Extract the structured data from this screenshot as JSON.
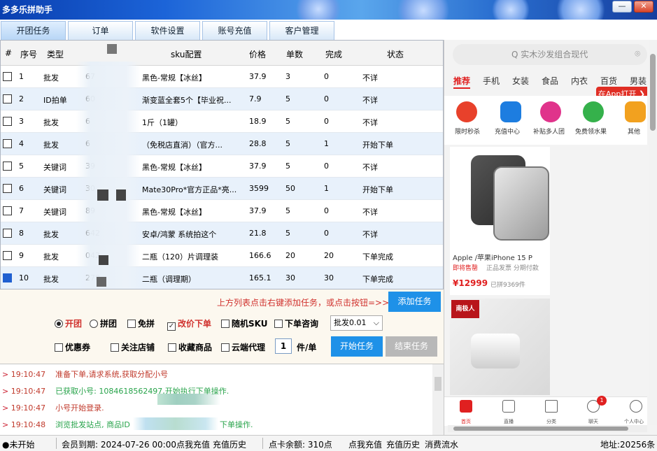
{
  "app": {
    "title": "多多乐拼助手",
    "min": "—",
    "close": "✕"
  },
  "tabs": [
    {
      "label": "开团任务"
    },
    {
      "label": "订单"
    },
    {
      "label": "软件设置"
    },
    {
      "label": "账号充值"
    },
    {
      "label": "客户管理"
    }
  ],
  "grid": {
    "columns": [
      "#",
      "序号",
      "类型",
      "sku配置",
      "价格",
      "单数",
      "完成",
      "状态"
    ],
    "rows": [
      {
        "no": "1",
        "type": "批发",
        "id": "67",
        "sku": "黑色-常规【冰丝】",
        "price": "37.9",
        "count": "3",
        "done": "0",
        "status": "不详"
      },
      {
        "no": "2",
        "type": "ID拍单",
        "id": "60",
        "sku": "渐变蓝全套5个【毕业祝...",
        "price": "7.9",
        "count": "5",
        "done": "0",
        "status": "不详"
      },
      {
        "no": "3",
        "type": "批发",
        "id": "6",
        "sku": "1斤（1罐）",
        "price": "18.9",
        "count": "5",
        "done": "0",
        "status": "不详"
      },
      {
        "no": "4",
        "type": "批发",
        "id": "6",
        "sku": "（免税店直消）（官方...",
        "price": "28.8",
        "count": "5",
        "done": "1",
        "status": "开始下单"
      },
      {
        "no": "5",
        "type": "关键词",
        "id": "39",
        "sku": "黑色-常规【冰丝】",
        "price": "37.9",
        "count": "5",
        "done": "0",
        "status": "不详"
      },
      {
        "no": "6",
        "type": "关键词",
        "id": "30",
        "sku": "Mate30Pro*官方正品*亮...",
        "price": "3599",
        "count": "50",
        "done": "1",
        "status": "开始下单"
      },
      {
        "no": "7",
        "type": "关键词",
        "id": "89",
        "sku": "黑色-常规【冰丝】",
        "price": "37.9",
        "count": "5",
        "done": "0",
        "status": "不详"
      },
      {
        "no": "8",
        "type": "批发",
        "id": "642",
        "sku": "安卓/鸿蒙 系统拍这个",
        "price": "21.8",
        "count": "5",
        "done": "0",
        "status": "不详"
      },
      {
        "no": "9",
        "type": "批发",
        "id": "042",
        "sku": "二瓶（120）片调理装",
        "price": "166.6",
        "count": "20",
        "done": "20",
        "status": "下单完成"
      },
      {
        "no": "10",
        "type": "批发",
        "id": "278",
        "sku": "二瓶（调理期）",
        "price": "165.1",
        "count": "30",
        "done": "30",
        "status": "下单完成"
      }
    ]
  },
  "panel": {
    "hint": "上方列表点击右键添加任务，或点击按钮=>>",
    "add_task": "添加任务",
    "opt_kaituan": "开团",
    "opt_cantuan": "拼团",
    "opt_mianpin": "免拼",
    "opt_gaijia": "改价下单",
    "opt_suiji": "随机SKU",
    "opt_zixun": "下单咨询",
    "select_value": "批发0.01",
    "opt_youhui": "优惠券",
    "opt_guanzhu": "关注店铺",
    "opt_shoucang": "收藏商品",
    "opt_yunduan": "云端代理",
    "qty": "1",
    "qty_unit": "件/单",
    "start": "开始任务",
    "stop": "结束任务"
  },
  "log": [
    {
      "time": "19:10:47",
      "text": "准备下单,请求系统,获取分配小号",
      "color": "#c0392b"
    },
    {
      "time": "19:10:47",
      "text": "已获取小号: 1084618562497,开始执行下单操作.",
      "color": "#27a34a"
    },
    {
      "time": "19:10:47",
      "text": "小号开始登录.",
      "color": "#c0392b"
    },
    {
      "time": "19:10:48",
      "text": "浏览批发站点, 商品ID",
      "tail": "下单操作.",
      "color": "#27a34a"
    }
  ],
  "status": {
    "state": "●未开始",
    "member": "会员到期: 2024-07-26 00:00",
    "member_link": "点我充值",
    "member_hist": "充值历史",
    "points": "点卡余额: 310点",
    "points_link": "点我充值",
    "points_hist": "充值历史",
    "consume": "消费流水",
    "address": "地址:20256条"
  },
  "mobile": {
    "search_placeholder": "Q 实木沙发组合现代",
    "cats": [
      "推荐",
      "手机",
      "女装",
      "食品",
      "内衣",
      "百货",
      "男装"
    ],
    "open_app": "在App打开 ❯",
    "icons": [
      {
        "label": "限时秒杀",
        "color": "#e8412b"
      },
      {
        "label": "充值中心",
        "color": "#1d7de0"
      },
      {
        "label": "补贴多人团",
        "color": "#e0338b"
      },
      {
        "label": "免费领水果",
        "color": "#35b14b"
      },
      {
        "label": "其他",
        "color": "#f2a11f"
      }
    ],
    "product1": {
      "title": "Apple /苹果iPhone 15 P",
      "tag": "即将售罄",
      "tag2": "正品发票 分期付款",
      "price": "¥12999",
      "sold": "已拼9369件"
    },
    "product2": {
      "brand": "南极人"
    },
    "badge_count": "1",
    "nav": [
      "首页",
      "直播",
      "分类",
      "聊天",
      "个人中心"
    ]
  }
}
